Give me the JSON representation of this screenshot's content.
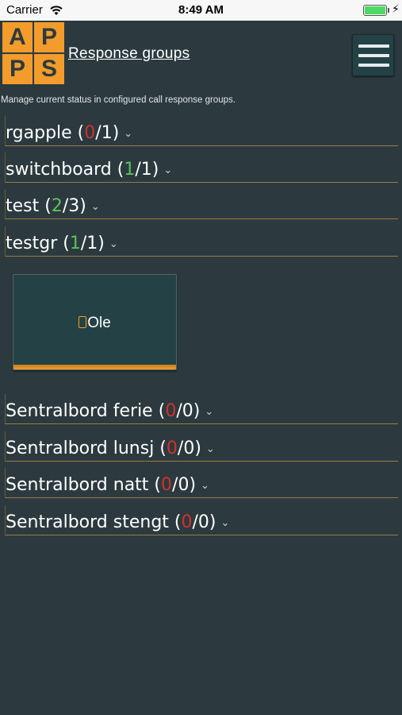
{
  "status": {
    "carrier": "Carrier",
    "time": "8:49 AM"
  },
  "header": {
    "logo_letters": [
      "A",
      "P",
      "P",
      "S"
    ],
    "title": "Response groups",
    "menu_icon": "hamburger-icon"
  },
  "subtitle": "Manage current status in configured call response groups.",
  "groups_top": [
    {
      "name": "rgapple",
      "active": "0",
      "total": "1"
    },
    {
      "name": "switchboard",
      "active": "1",
      "total": "1"
    },
    {
      "name": "test",
      "active": "2",
      "total": "3"
    },
    {
      "name": "testgr",
      "active": "1",
      "total": "1"
    }
  ],
  "member": {
    "name": "Ole",
    "icon": "mobile-phone-icon"
  },
  "groups_bottom": [
    {
      "name": "Sentralbord ferie",
      "active": "0",
      "total": "0"
    },
    {
      "name": "Sentralbord lunsj",
      "active": "0",
      "total": "0"
    },
    {
      "name": "Sentralbord natt",
      "active": "0",
      "total": "0"
    },
    {
      "name": "Sentralbord stengt",
      "active": "0",
      "total": "0"
    }
  ],
  "colors": {
    "accent": "#f39c2b",
    "background": "#2c3a3f",
    "zero": "#d2312a",
    "positive": "#5cc15c"
  }
}
